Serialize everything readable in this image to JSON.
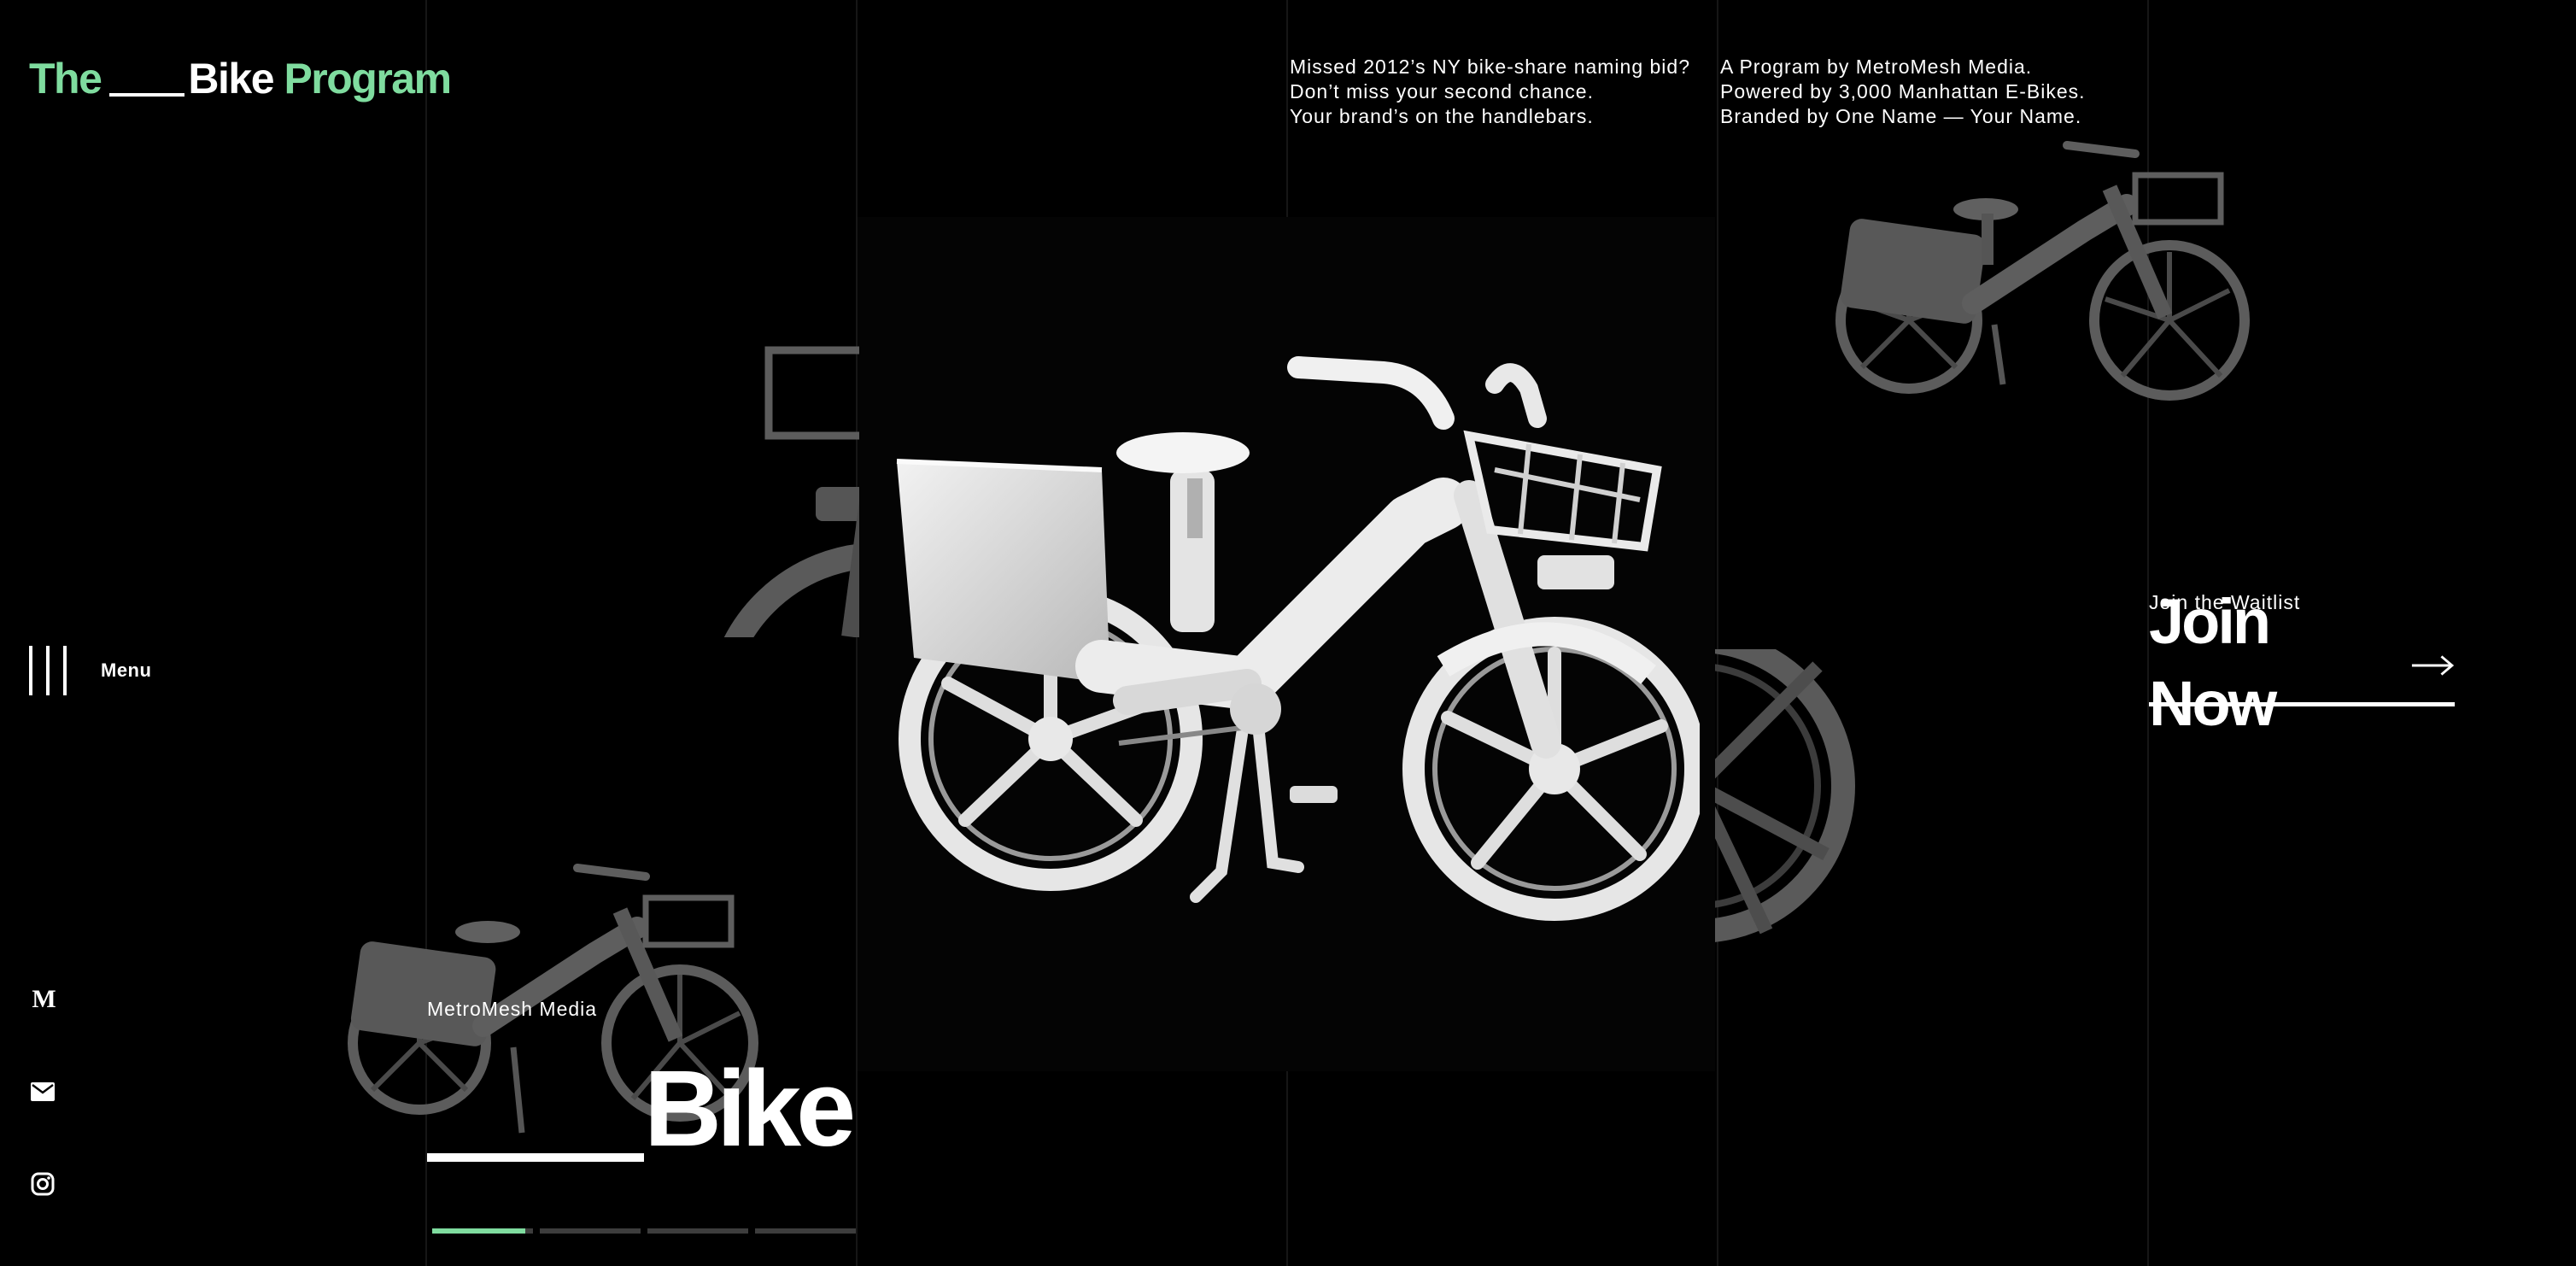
{
  "header": {
    "logo_the": "The",
    "logo_bike": "Bike",
    "logo_program": "Program"
  },
  "menu": {
    "label": "Menu"
  },
  "social": {
    "metromesh_glyph": "M",
    "icons": [
      "metromesh-logo-icon",
      "mail-icon",
      "instagram-icon"
    ]
  },
  "taglines": {
    "left": [
      "Missed 2012’s NY bike-share naming bid?",
      "Don’t miss your second chance.",
      "Your brand’s on the handlebars."
    ],
    "right": [
      "A Program by MetroMesh Media.",
      "Powered by 3,000 Manhattan E-Bikes.",
      "Branded by One Name — Your Name."
    ]
  },
  "cta": {
    "label": "Join the Waitlist",
    "button": "Join Now"
  },
  "hero": {
    "brand": "MetroMesh Media",
    "word": "Bike"
  },
  "slider": {
    "count": 4,
    "active_index": 0,
    "active_progress": 0.92
  },
  "colors": {
    "accent": "#7fdc9f",
    "background": "#000000",
    "text": "#ffffff"
  }
}
